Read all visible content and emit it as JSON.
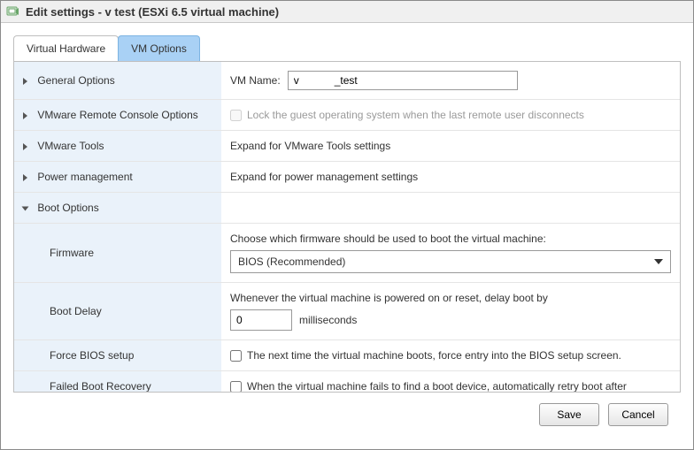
{
  "window": {
    "title": "Edit settings - v            test (ESXi 6.5 virtual machine)"
  },
  "tabs": {
    "hardware": "Virtual Hardware",
    "options": "VM Options"
  },
  "rows": {
    "general": {
      "label": "General Options",
      "vm_name_label": "VM Name:",
      "vm_name_value": "v            _test"
    },
    "remote": {
      "label": "VMware Remote Console Options",
      "lock_text": "Lock the guest operating system when the last remote user disconnects"
    },
    "tools": {
      "label": "VMware Tools",
      "value": "Expand for VMware Tools settings"
    },
    "power": {
      "label": "Power management",
      "value": "Expand for power management settings"
    },
    "boot": {
      "label": "Boot Options",
      "firmware": {
        "label": "Firmware",
        "desc": "Choose which firmware should be used to boot the virtual machine:",
        "selected": "BIOS (Recommended)"
      },
      "delay": {
        "label": "Boot Delay",
        "desc": "Whenever the virtual machine is powered on or reset, delay boot by",
        "value": "0",
        "unit": "milliseconds"
      },
      "force_bios": {
        "label": "Force BIOS setup",
        "text": "The next time the virtual machine boots, force entry into the BIOS setup screen."
      },
      "failed": {
        "label": "Failed Boot Recovery",
        "text": "When the virtual machine fails to find a boot device, automatically retry boot after"
      }
    }
  },
  "footer": {
    "save": "Save",
    "cancel": "Cancel"
  }
}
